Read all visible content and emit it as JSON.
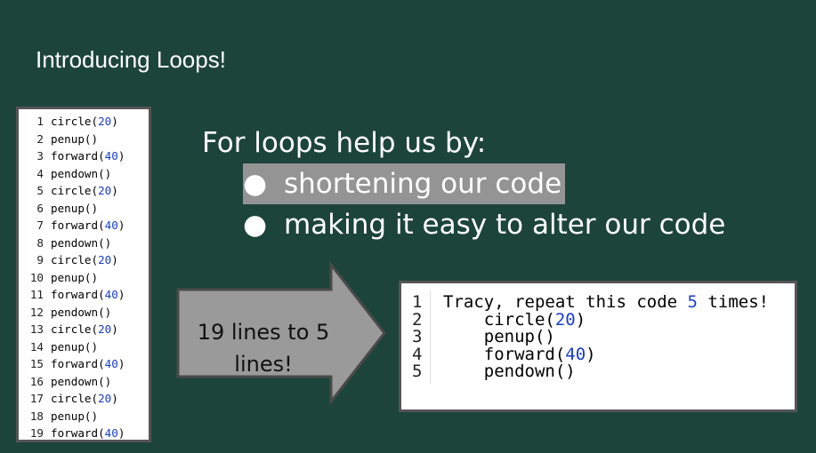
{
  "slide": {
    "title": "Introducing Loops!"
  },
  "left_code": {
    "lines": [
      {
        "n": "1",
        "pre": "circle(",
        "num": "20",
        "post": ")"
      },
      {
        "n": "2",
        "pre": "penup()",
        "num": "",
        "post": ""
      },
      {
        "n": "3",
        "pre": "forward(",
        "num": "40",
        "post": ")"
      },
      {
        "n": "4",
        "pre": "pendown()",
        "num": "",
        "post": ""
      },
      {
        "n": "5",
        "pre": "circle(",
        "num": "20",
        "post": ")"
      },
      {
        "n": "6",
        "pre": "penup()",
        "num": "",
        "post": ""
      },
      {
        "n": "7",
        "pre": "forward(",
        "num": "40",
        "post": ")"
      },
      {
        "n": "8",
        "pre": "pendown()",
        "num": "",
        "post": ""
      },
      {
        "n": "9",
        "pre": "circle(",
        "num": "20",
        "post": ")"
      },
      {
        "n": "10",
        "pre": "penup()",
        "num": "",
        "post": ""
      },
      {
        "n": "11",
        "pre": "forward(",
        "num": "40",
        "post": ")"
      },
      {
        "n": "12",
        "pre": "pendown()",
        "num": "",
        "post": ""
      },
      {
        "n": "13",
        "pre": "circle(",
        "num": "20",
        "post": ")"
      },
      {
        "n": "14",
        "pre": "penup()",
        "num": "",
        "post": ""
      },
      {
        "n": "15",
        "pre": "forward(",
        "num": "40",
        "post": ")"
      },
      {
        "n": "16",
        "pre": "pendown()",
        "num": "",
        "post": ""
      },
      {
        "n": "17",
        "pre": "circle(",
        "num": "20",
        "post": ")"
      },
      {
        "n": "18",
        "pre": "penup()",
        "num": "",
        "post": ""
      },
      {
        "n": "19",
        "pre": "forward(",
        "num": "40",
        "post": ")"
      }
    ]
  },
  "body": {
    "heading": "For loops help us by:",
    "bullets": [
      {
        "text": "shortening our code",
        "highlighted": true
      },
      {
        "text": "making it easy to alter our code",
        "highlighted": false
      }
    ],
    "bullet_glyph": "●"
  },
  "arrow": {
    "line1": "19 lines to 5",
    "line2": "lines!"
  },
  "right_code": {
    "lines": [
      {
        "n": "1",
        "pre": "Tracy, repeat this code ",
        "num": "5",
        "post": " times!"
      },
      {
        "n": "2",
        "pre": "    circle(",
        "num": "20",
        "post": ")"
      },
      {
        "n": "3",
        "pre": "    penup()",
        "num": "",
        "post": ""
      },
      {
        "n": "4",
        "pre": "    forward(",
        "num": "40",
        "post": ")"
      },
      {
        "n": "5",
        "pre": "    pendown()",
        "num": "",
        "post": ""
      }
    ]
  },
  "colors": {
    "background": "#1c443b",
    "highlight": "#949494",
    "arrow_fill": "#9a9a9a",
    "code_number": "#1a3cc7"
  }
}
